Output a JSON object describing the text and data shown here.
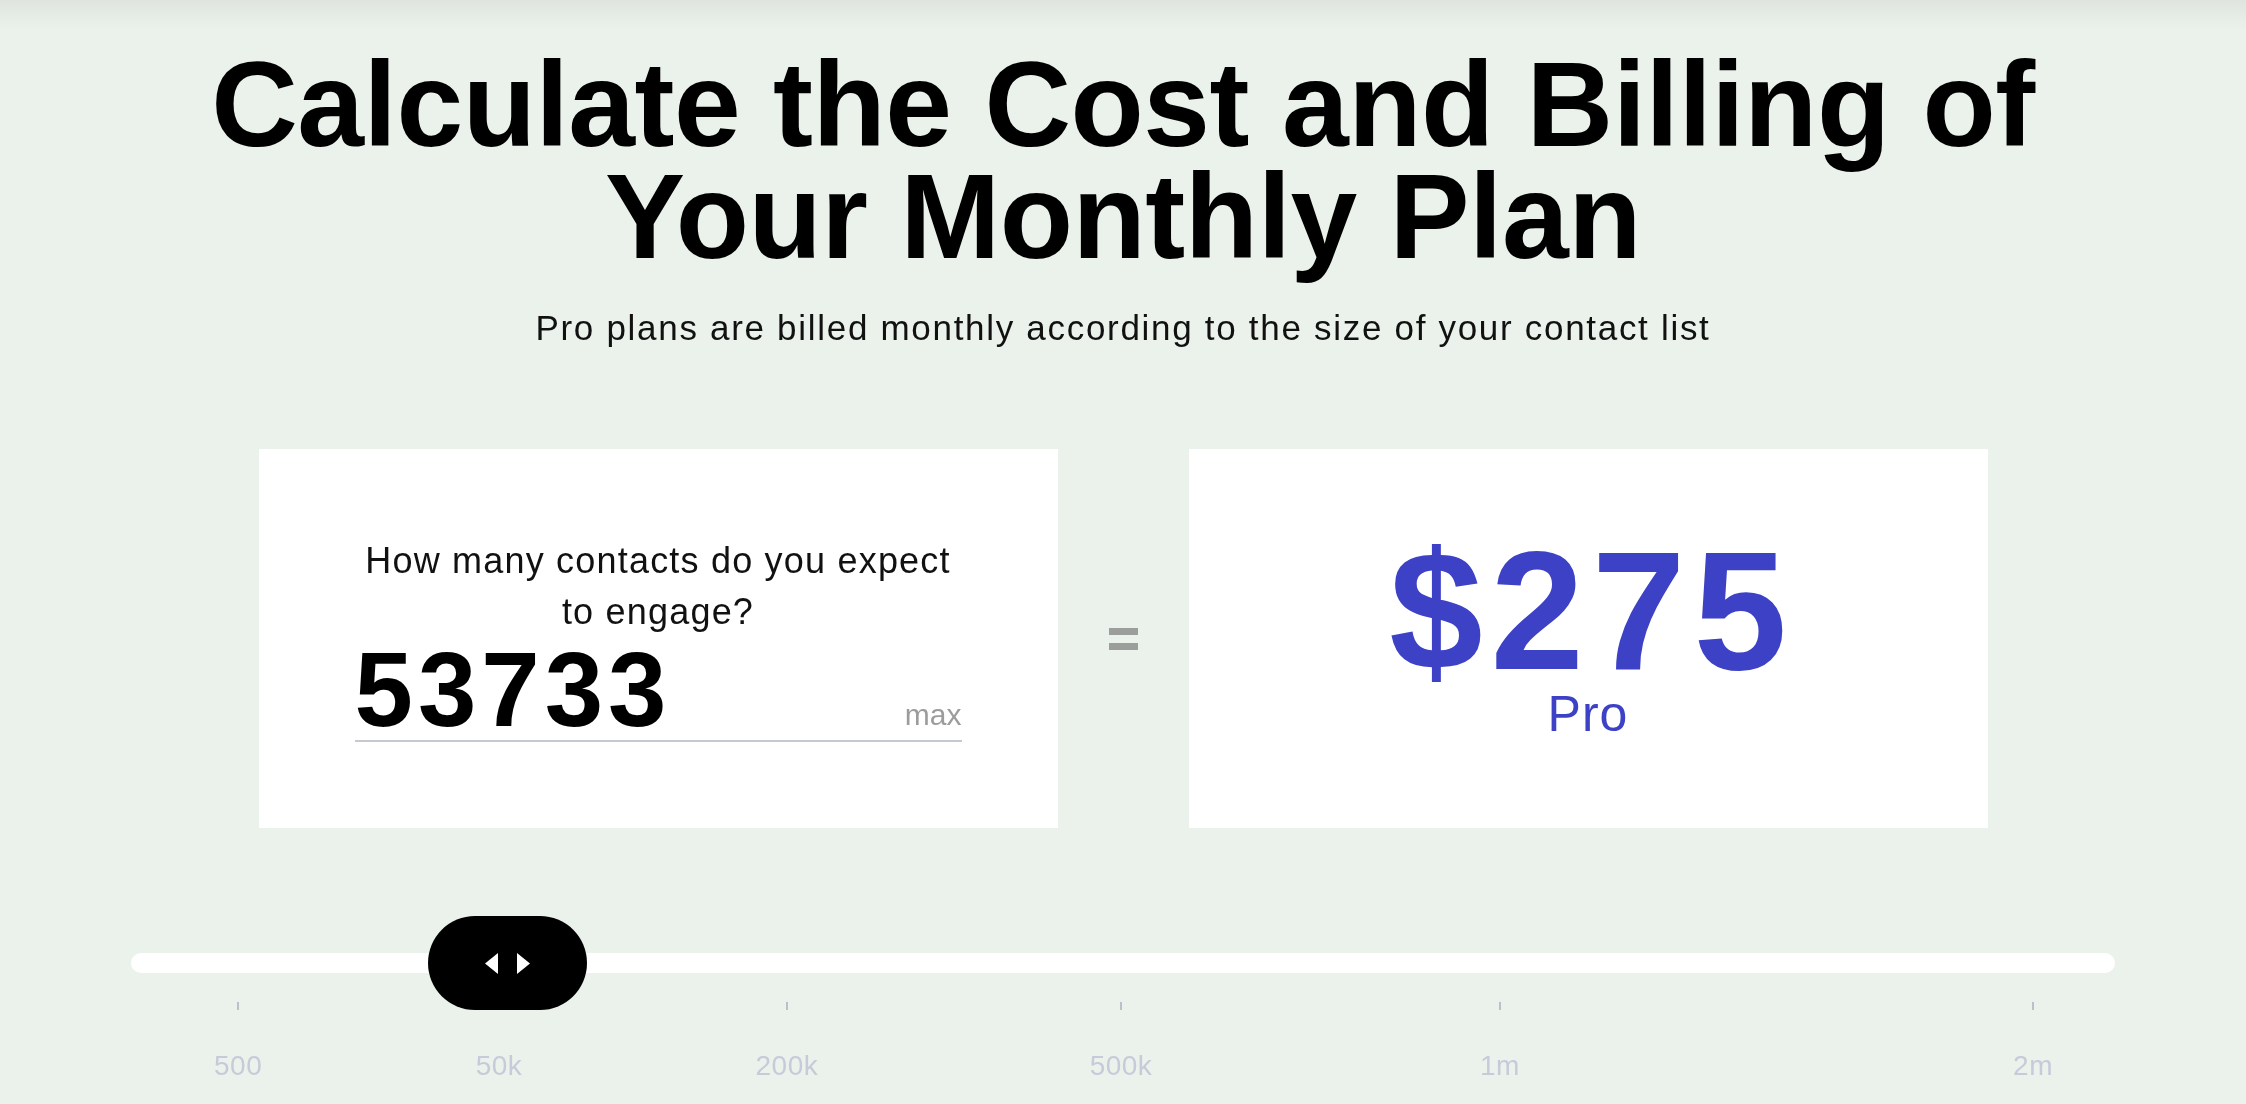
{
  "header": {
    "title": "Calculate the Cost and Billing of Your Monthly Plan",
    "subtitle": "Pro plans are billed monthly according to the size of your contact list"
  },
  "calculator": {
    "question": "How many contacts do you expect to engage?",
    "contacts_value": "53733",
    "max_button": "max",
    "price": "$275",
    "plan": "Pro"
  },
  "slider": {
    "level": 0.19,
    "scale_labels": [
      "500",
      "50k",
      "200k",
      "500k",
      "1m",
      "2m"
    ]
  }
}
